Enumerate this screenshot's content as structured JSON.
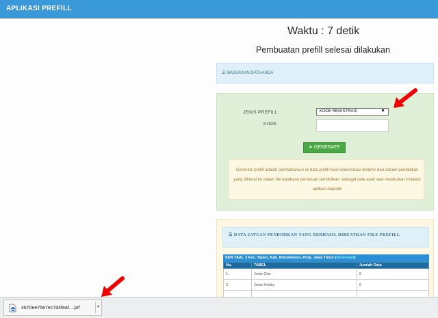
{
  "app": {
    "title": "APLIKASI PREFILL"
  },
  "status": {
    "timer": "Waktu : 7 detik",
    "message": "Pembuatan prefill selesai dilakukan"
  },
  "header_panel": {
    "icon": "list-icon",
    "label": "MASUKKAN DATA ANDA"
  },
  "form": {
    "jenis_label": "JENIS PREFILL",
    "jenis_value": "KODE REGISTRASI",
    "kode_label": "KODE",
    "kode_value": "",
    "generate_label": "GENERATE",
    "generate_icon": "sign-in-icon",
    "info_text": "Generate prefill adalah pembaharuan isi data prefill hasil sinkronisasi terakhir dari satuan pendidikan yang dikenal ke dalam file database persatuan pendidikan, sebagai data awal saat melakukan instalasi aplikasi dapodik"
  },
  "result": {
    "heading": "DATA SATUAN PENDIDIKAN YANG BERHASIL DIBUATKAN FILE PREFILL",
    "caption": "SDN TAAL 3 Kec. Tapen, Kab. Bondowoso, Prop. Jawa Timur (",
    "caption_link": "Download",
    "caption_end": ")",
    "columns": [
      "No.",
      "TABEL",
      "Jumlah Data"
    ],
    "rows": [
      [
        "1.",
        "Jenis Cita",
        "8"
      ],
      [
        "2.",
        "Jenis Hobby",
        "6"
      ]
    ]
  },
  "download": {
    "filename": "4670ee75e7ec7d4feaf....prf"
  },
  "colors": {
    "navbar": "#3a99d8",
    "success": "#dfefd8",
    "info": "#dff0f8",
    "warning": "#fcf8e4",
    "button": "#4aa843",
    "arrow": "#ee0000"
  }
}
